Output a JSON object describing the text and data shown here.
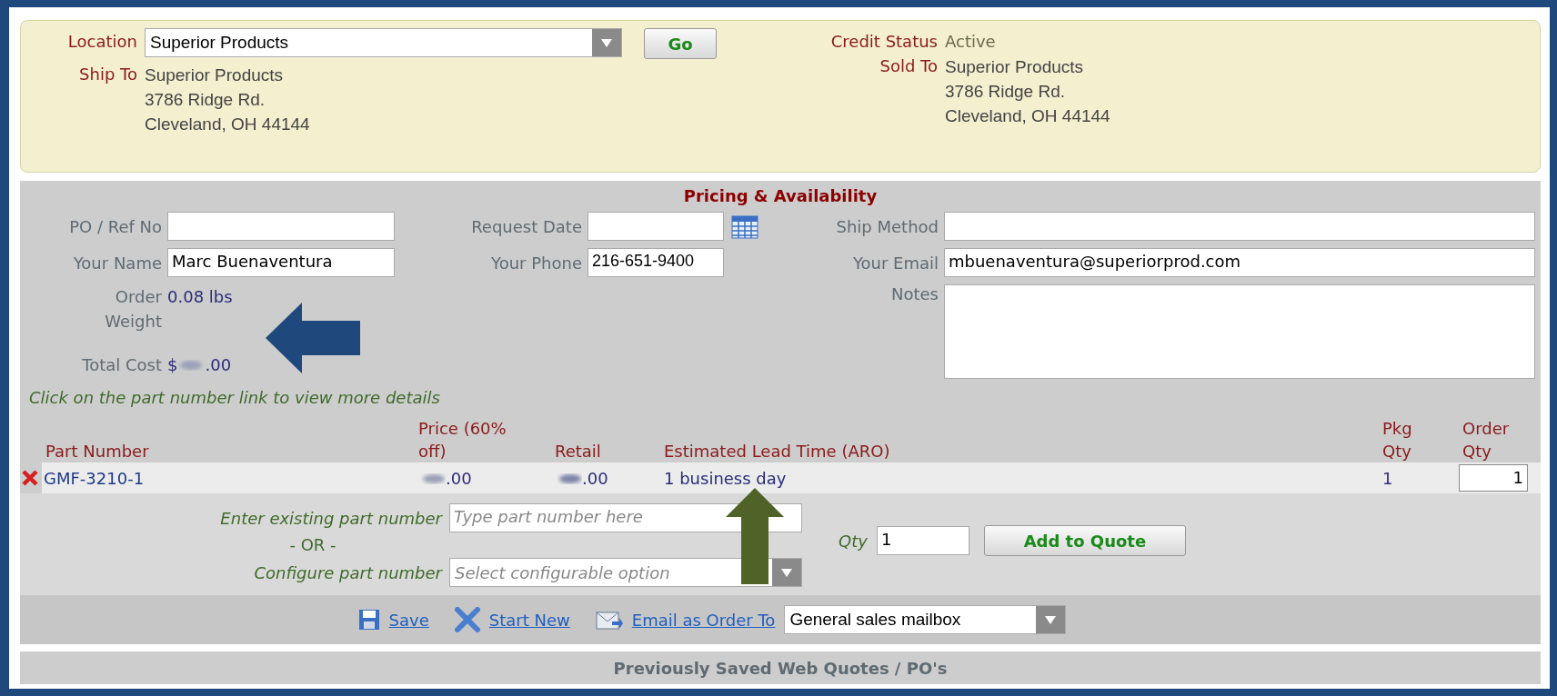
{
  "customer": {
    "location": {
      "label": "Location",
      "value": "Superior Products"
    },
    "go_button": "Go",
    "credit_status": {
      "label": "Credit Status",
      "value": "Active"
    },
    "ship_to": {
      "label": "Ship To",
      "lines": [
        "Superior Products",
        "3786 Ridge Rd.",
        "Cleveland, OH 44144"
      ]
    },
    "sold_to": {
      "label": "Sold To",
      "lines": [
        "Superior Products",
        "3786 Ridge Rd.",
        "Cleveland, OH 44144"
      ]
    }
  },
  "pricing": {
    "title": "Pricing & Availability",
    "fields": [
      {
        "label": "PO / Ref No",
        "kind": "text"
      },
      {
        "label": "Request Date",
        "kind": "date"
      },
      {
        "label": "Ship Method",
        "kind": "text"
      },
      {
        "label": "Your Name",
        "kind": "text",
        "value": "Marc Buenaventura"
      },
      {
        "label": "Your Phone",
        "kind": "text",
        "value": "216-651-9400"
      },
      {
        "label": "Your Email",
        "kind": "text",
        "value": "mbuenaventura@superiorprod.com"
      }
    ],
    "order_weight": {
      "label": "Order Weight",
      "value": "0.08 lbs"
    },
    "total_cost": {
      "label": "Total Cost",
      "prefix": "$",
      "redacted": true,
      "value": ".00"
    },
    "notes": {
      "label": "Notes"
    },
    "hint": "Click on the part number link to view more details",
    "columns": [
      "Part Number",
      "Price (60% off)",
      "Retail",
      "Estimated Lead Time (ARO)",
      "Pkg Qty",
      "Order Qty"
    ],
    "rows": [
      {
        "part_number": "GMF-3210-1",
        "price": ".00",
        "price_redacted": true,
        "retail": ".00",
        "retail_redacted": true,
        "lead_time": "1 business day",
        "pkg_qty": "1",
        "order_qty": "1"
      }
    ],
    "entry": {
      "part_label": "Enter existing part number",
      "part_placeholder": "Type part number here",
      "or": "- OR -",
      "config_label": "Configure part number",
      "config_placeholder": "Select configurable option",
      "qty_label": "Qty",
      "qty_value": "1",
      "add_button": "Add to Quote"
    }
  },
  "actions": {
    "save": "Save",
    "start_new": "Start New",
    "email": "Email as Order To",
    "mailbox": "General sales mailbox"
  },
  "saved_header": "Previously Saved Web Quotes / PO's"
}
